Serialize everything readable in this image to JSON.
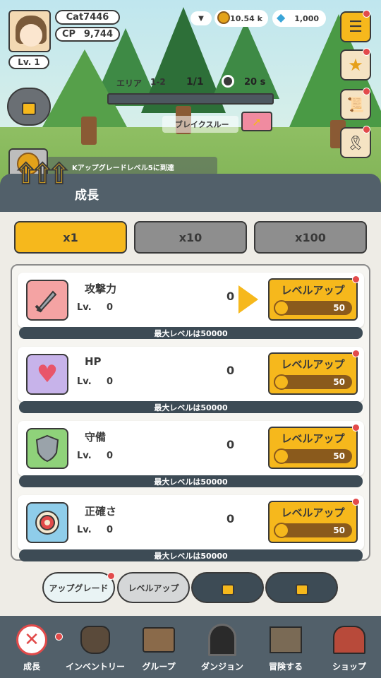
{
  "player": {
    "name": "Cat7446",
    "cp_label": "CP",
    "cp": "9,744",
    "level": "Lv. 1"
  },
  "currency": {
    "gold": "10.54 k",
    "gems": "1,000"
  },
  "stage": {
    "area_label": "エリア",
    "area": "1-2",
    "wave": "1/1",
    "timer": "20 s",
    "breakthrough_label": "ブレイクスルー"
  },
  "notice": "Kアップグレードレベル5に到達",
  "panel": {
    "title": "成長"
  },
  "multipliers": [
    {
      "label": "x1",
      "active": true
    },
    {
      "label": "x10",
      "active": false
    },
    {
      "label": "x100",
      "active": false
    }
  ],
  "stats": [
    {
      "name": "攻撃力",
      "lv_label": "Lv.",
      "lv": "0",
      "value": "0",
      "btn": "レベルアップ",
      "cost": "50",
      "max": "最大レベルは50000",
      "icon": "sword-icon",
      "color": "#f4a3a3"
    },
    {
      "name": "HP",
      "lv_label": "Lv.",
      "lv": "0",
      "value": "0",
      "btn": "レベルアップ",
      "cost": "50",
      "max": "最大レベルは50000",
      "icon": "heart-icon",
      "color": "#c7b3ea"
    },
    {
      "name": "守備",
      "lv_label": "Lv.",
      "lv": "0",
      "value": "0",
      "btn": "レベルアップ",
      "cost": "50",
      "max": "最大レベルは50000",
      "icon": "shield-icon",
      "color": "#8fd27a"
    },
    {
      "name": "正確さ",
      "lv_label": "Lv.",
      "lv": "0",
      "value": "0",
      "btn": "レベルアップ",
      "cost": "50",
      "max": "最大レベルは50000",
      "icon": "target-icon",
      "color": "#8fcdea"
    }
  ],
  "subtabs": [
    {
      "label": "アップグレード",
      "locked": false
    },
    {
      "label": "レベルアップ",
      "locked": false
    },
    {
      "label": "",
      "locked": true
    },
    {
      "label": "",
      "locked": true
    }
  ],
  "nav": [
    {
      "label": "成長",
      "icon": "close-circle-icon"
    },
    {
      "label": "インベントリー",
      "icon": "bag-icon"
    },
    {
      "label": "グループ",
      "icon": "cards-icon"
    },
    {
      "label": "ダンジョン",
      "icon": "gate-icon"
    },
    {
      "label": "冒険する",
      "icon": "map-icon"
    },
    {
      "label": "ショップ",
      "icon": "shop-icon"
    }
  ]
}
